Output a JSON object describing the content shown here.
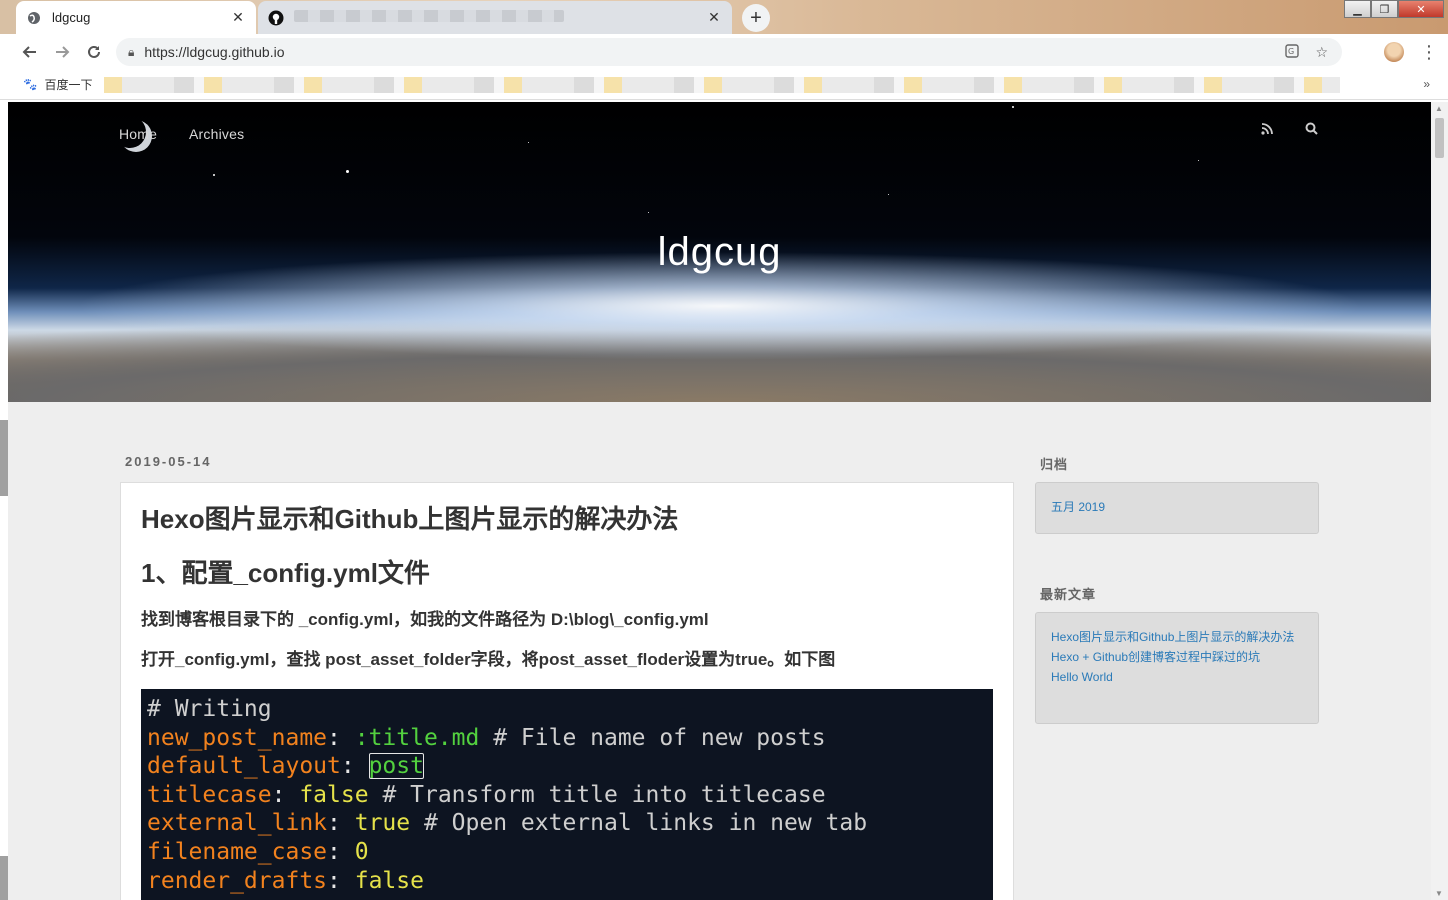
{
  "browser": {
    "tabs": [
      {
        "title": "ldgcug",
        "active": true
      },
      {
        "title": "",
        "active": false
      }
    ],
    "new_tab_symbol": "+",
    "address": "https://ldgcug.github.io",
    "bookmarks_first": "百度一下",
    "window_controls": {
      "minimize": "▁",
      "restore": "❐",
      "close": "✕"
    }
  },
  "site": {
    "nav": [
      {
        "label": "Home"
      },
      {
        "label": "Archives"
      }
    ],
    "icons": {
      "rss": "rss-icon",
      "search": "search-icon"
    },
    "title": "ldgcug"
  },
  "post": {
    "date": "2019-05-14",
    "title": "Hexo图片显示和Github上图片显示的解决办法",
    "heading": "1、配置_config.yml文件",
    "para1": "找到博客根目录下的 _config.yml，如我的文件路径为 D:\\blog\\_config.yml",
    "para2": "打开_config.yml，查找 post_asset_folder字段，将post_asset_floder设置为true。如下图",
    "code": {
      "l1": "# Writing",
      "l2_key": "new_post_name",
      "l2_val": ":title.md",
      "l2_cmt": "# File name of new posts",
      "l3_key": "default_layout",
      "l3_val": "post",
      "l4_key": "titlecase",
      "l4_val": "false",
      "l4_cmt": "# Transform title into titlecase",
      "l5_key": "external_link",
      "l5_val": "true",
      "l5_cmt": "# Open external links in new tab",
      "l6_key": "filename_case",
      "l6_val": "0",
      "l7_key": "render_drafts",
      "l7_val": "false"
    }
  },
  "sidebar": {
    "archive_head": "归档",
    "archive_items": [
      "五月 2019"
    ],
    "recent_head": "最新文章",
    "recent_items": [
      "Hexo图片显示和Github上图片显示的解决办法",
      "Hexo + Github创建博客过程中踩过的坑",
      "Hello World"
    ]
  },
  "colors": {
    "code_bg": "#0d1421",
    "code_key": "#f2821e",
    "code_string": "#53d13f",
    "code_bool": "#e5e24a",
    "link": "#2a7ab8"
  }
}
